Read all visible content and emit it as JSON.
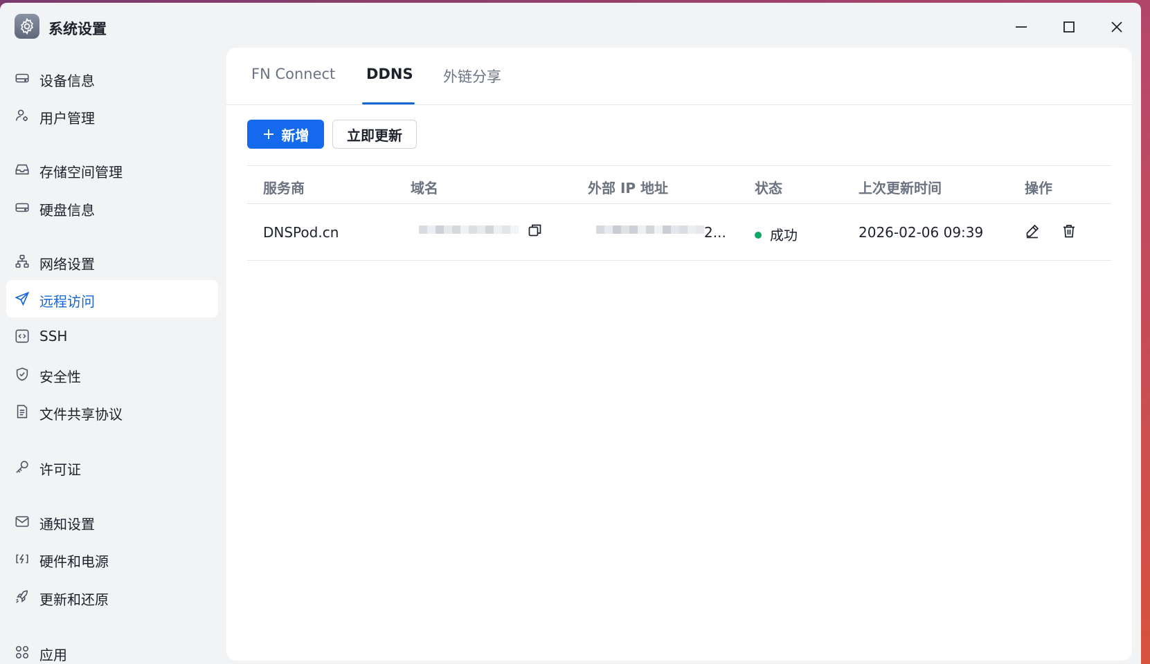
{
  "window": {
    "title": "系统设置"
  },
  "sidebar": {
    "items": [
      {
        "label": "设备信息",
        "icon": "drive-icon"
      },
      {
        "label": "用户管理",
        "icon": "user-gear-icon"
      },
      {
        "label": "存储空间管理",
        "icon": "inbox-icon"
      },
      {
        "label": "硬盘信息",
        "icon": "drive-icon"
      },
      {
        "label": "网络设置",
        "icon": "network-icon"
      },
      {
        "label": "远程访问",
        "icon": "send-icon",
        "active": true
      },
      {
        "label": "SSH",
        "icon": "code-icon"
      },
      {
        "label": "安全性",
        "icon": "shield-check-icon"
      },
      {
        "label": "文件共享协议",
        "icon": "document-icon"
      },
      {
        "label": "许可证",
        "icon": "key-icon"
      },
      {
        "label": "通知设置",
        "icon": "mail-icon"
      },
      {
        "label": "硬件和电源",
        "icon": "power-icon"
      },
      {
        "label": "更新和还原",
        "icon": "rocket-icon"
      },
      {
        "label": "应用",
        "icon": "apps-icon"
      }
    ]
  },
  "tabs": [
    {
      "label": "FN Connect"
    },
    {
      "label": "DDNS",
      "active": true
    },
    {
      "label": "外链分享"
    }
  ],
  "toolbar": {
    "add_label": "新增",
    "update_label": "立即更新"
  },
  "table": {
    "headers": [
      "服务商",
      "域名",
      "外部 IP 地址",
      "状态",
      "上次更新时间",
      "操作"
    ],
    "rows": [
      {
        "provider": "DNSPod.cn",
        "ip_suffix": "2...",
        "status": "成功",
        "last_update": "2026-02-06 09:39"
      }
    ]
  },
  "colors": {
    "accent": "#1569ec",
    "status_success": "#11a66a"
  }
}
